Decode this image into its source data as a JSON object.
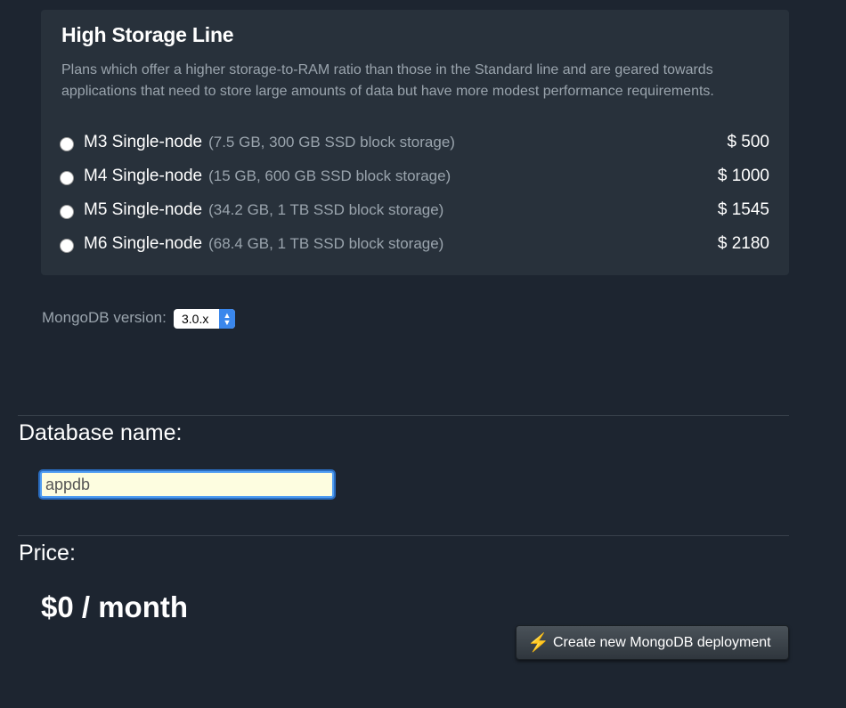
{
  "panel": {
    "title": "High Storage Line",
    "description": "Plans which offer a higher storage-to-RAM ratio than those in the Standard line and are geared towards applications that need to store large amounts of data but have more modest performance requirements.",
    "plans": [
      {
        "name": "M3 Single-node",
        "spec": "(7.5 GB, 300 GB SSD block storage)",
        "price": "$ 500"
      },
      {
        "name": "M4 Single-node",
        "spec": "(15 GB, 600 GB SSD block storage)",
        "price": "$ 1000"
      },
      {
        "name": "M5 Single-node",
        "spec": "(34.2 GB, 1 TB SSD block storage)",
        "price": "$ 1545"
      },
      {
        "name": "M6 Single-node",
        "spec": "(68.4 GB, 1 TB SSD block storage)",
        "price": "$ 2180"
      }
    ]
  },
  "version": {
    "label": "MongoDB version:",
    "selected": "3.0.x"
  },
  "database": {
    "label": "Database name:",
    "value": "appdb"
  },
  "price": {
    "label": "Price:",
    "value": "$0 / month"
  },
  "create_button": {
    "label": "Create new MongoDB deployment",
    "icon": "lightning-bolt-icon"
  },
  "colors": {
    "background": "#1d2530",
    "panel": "#28313b",
    "muted_text": "#9aa4ad",
    "select_accent": "#3a87ec",
    "bolt": "#f5c518"
  }
}
